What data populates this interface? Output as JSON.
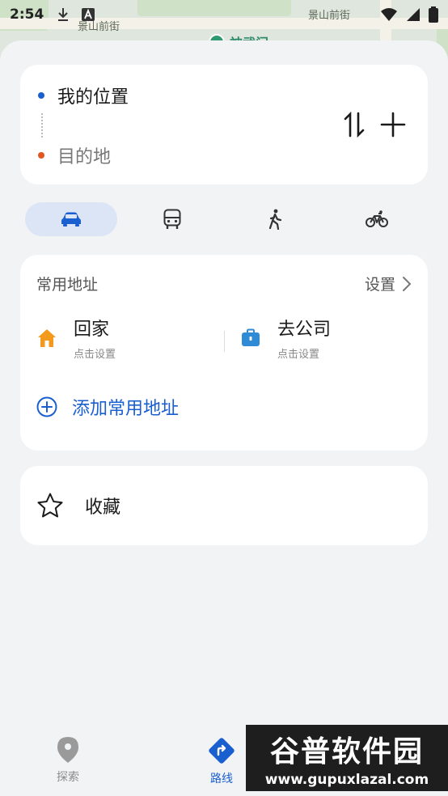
{
  "map": {
    "street_label_1": "景山前街",
    "street_label_2": "景山前街",
    "poi_label": "神武门"
  },
  "status_bar": {
    "time": "2:54"
  },
  "route": {
    "from_label": "我的位置",
    "to_label": "目的地",
    "colors": {
      "from_dot": "#1a5fcf",
      "to_dot": "#e0571f"
    }
  },
  "modes": {
    "items": [
      {
        "name": "car-icon",
        "active": true
      },
      {
        "name": "bus-icon",
        "active": false
      },
      {
        "name": "walk-icon",
        "active": false
      },
      {
        "name": "bike-icon",
        "active": false
      }
    ]
  },
  "common_addresses": {
    "title": "常用地址",
    "settings_label": "设置",
    "home": {
      "name": "回家",
      "sub": "点击设置"
    },
    "work": {
      "name": "去公司",
      "sub": "点击设置"
    },
    "add_label": "添加常用地址"
  },
  "favorites": {
    "label": "收藏"
  },
  "bottom_nav": {
    "explore_label": "探索",
    "route_label": "路线"
  },
  "watermark": {
    "title": "谷普软件园",
    "url": "www.gupuxlazal.com"
  },
  "colors": {
    "accent": "#1a5fcf",
    "home_icon": "#f39a1d",
    "work_icon": "#2f8bd6"
  }
}
